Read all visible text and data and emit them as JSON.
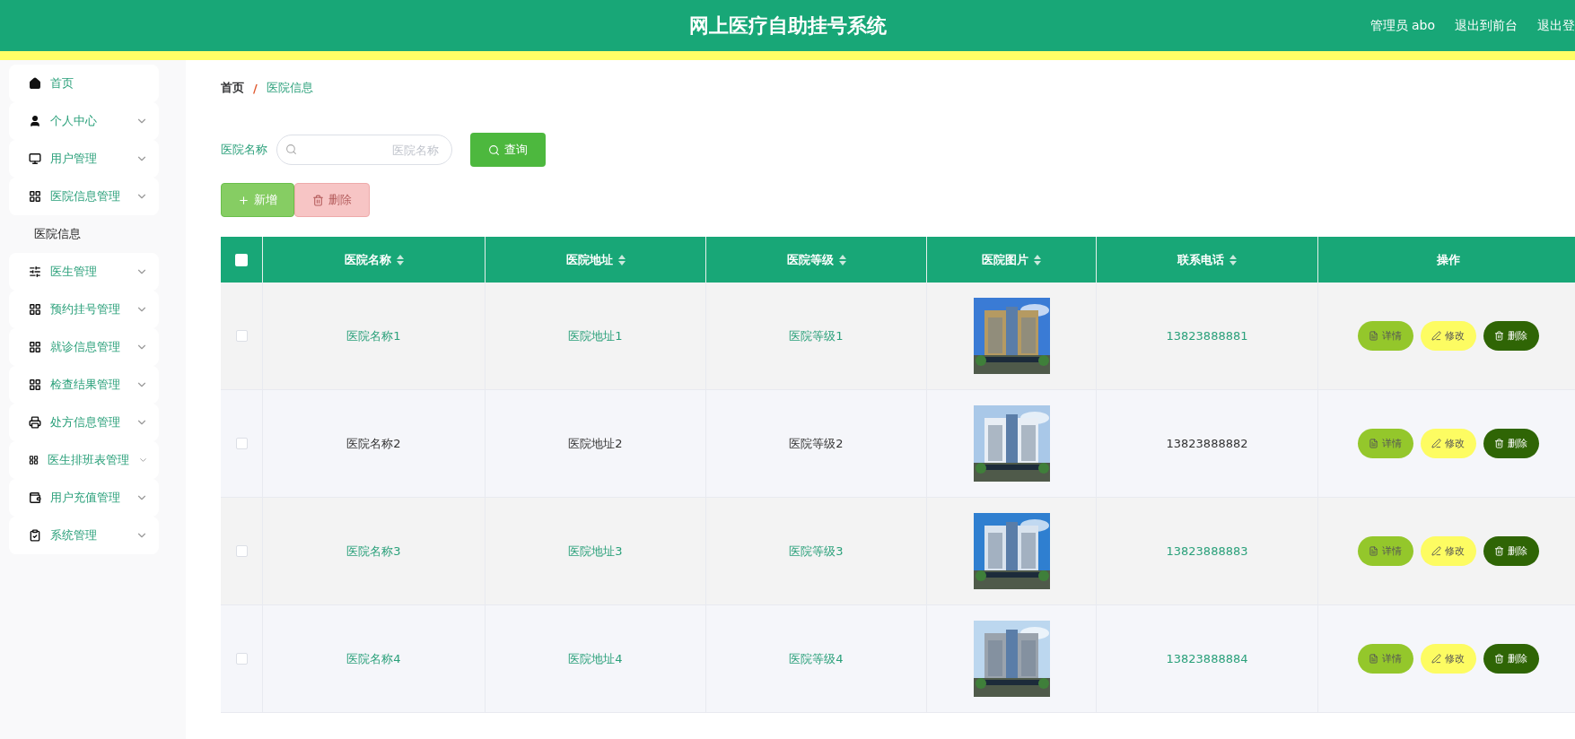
{
  "header": {
    "title": "网上医疗自助挂号系统",
    "links": [
      "管理员 abo",
      "退出到前台",
      "退出登"
    ]
  },
  "sidebar": {
    "items": [
      {
        "label": "首页",
        "expandable": false
      },
      {
        "label": "个人中心",
        "expandable": true
      },
      {
        "label": "用户管理",
        "expandable": true
      },
      {
        "label": "医院信息管理",
        "expandable": true,
        "children": [
          {
            "label": "医院信息",
            "selected": true
          }
        ]
      },
      {
        "label": "医生管理",
        "expandable": true
      },
      {
        "label": "预约挂号管理",
        "expandable": true
      },
      {
        "label": "就诊信息管理",
        "expandable": true
      },
      {
        "label": "检查结果管理",
        "expandable": true
      },
      {
        "label": "处方信息管理",
        "expandable": true
      },
      {
        "label": "医生排班表管理",
        "expandable": true
      },
      {
        "label": "用户充值管理",
        "expandable": true
      },
      {
        "label": "系统管理",
        "expandable": true
      }
    ]
  },
  "breadcrumb": {
    "separator": "/",
    "items": [
      "首页",
      "医院信息"
    ]
  },
  "search": {
    "label": "医院名称",
    "placeholder": "医院名称",
    "button": "查询"
  },
  "actions": [
    {
      "label": "新增",
      "kind": "add",
      "disabled": false
    },
    {
      "label": "删除",
      "kind": "delete",
      "disabled": true
    }
  ],
  "table": {
    "all_checked": false,
    "columns": [
      {
        "label": "医院名称",
        "sortable": true
      },
      {
        "label": "医院地址",
        "sortable": true
      },
      {
        "label": "医院等级",
        "sortable": true
      },
      {
        "label": "医院图片",
        "sortable": true
      },
      {
        "label": "联系电话",
        "sortable": true
      },
      {
        "label": "操作",
        "sortable": false
      }
    ],
    "rows": [
      {
        "checked": false,
        "hovered": false,
        "cells": [
          "医院名称1",
          "医院地址1",
          "医院等级1",
          {
            "kind": "picture"
          },
          "13823888881"
        ],
        "buttons": [
          {
            "label": "详情",
            "kind": "detail"
          },
          {
            "label": "修改",
            "kind": "edit"
          },
          {
            "label": "删除",
            "kind": "delete"
          }
        ]
      },
      {
        "checked": false,
        "hovered": true,
        "cells": [
          "医院名称2",
          "医院地址2",
          "医院等级2",
          {
            "kind": "picture"
          },
          "13823888882"
        ],
        "buttons": [
          {
            "label": "详情",
            "kind": "detail"
          },
          {
            "label": "修改",
            "kind": "edit"
          },
          {
            "label": "删除",
            "kind": "delete"
          }
        ]
      },
      {
        "checked": false,
        "hovered": false,
        "cells": [
          "医院名称3",
          "医院地址3",
          "医院等级3",
          {
            "kind": "picture"
          },
          "13823888883"
        ],
        "buttons": [
          {
            "label": "详情",
            "kind": "detail"
          },
          {
            "label": "修改",
            "kind": "edit"
          },
          {
            "label": "删除",
            "kind": "delete"
          }
        ]
      },
      {
        "checked": false,
        "hovered": false,
        "cells": [
          "医院名称4",
          "医院地址4",
          "医院等级4",
          {
            "kind": "picture"
          },
          "13823888884"
        ],
        "buttons": [
          {
            "label": "详情",
            "kind": "detail"
          },
          {
            "label": "修改",
            "kind": "edit"
          },
          {
            "label": "删除",
            "kind": "delete"
          }
        ]
      }
    ]
  }
}
